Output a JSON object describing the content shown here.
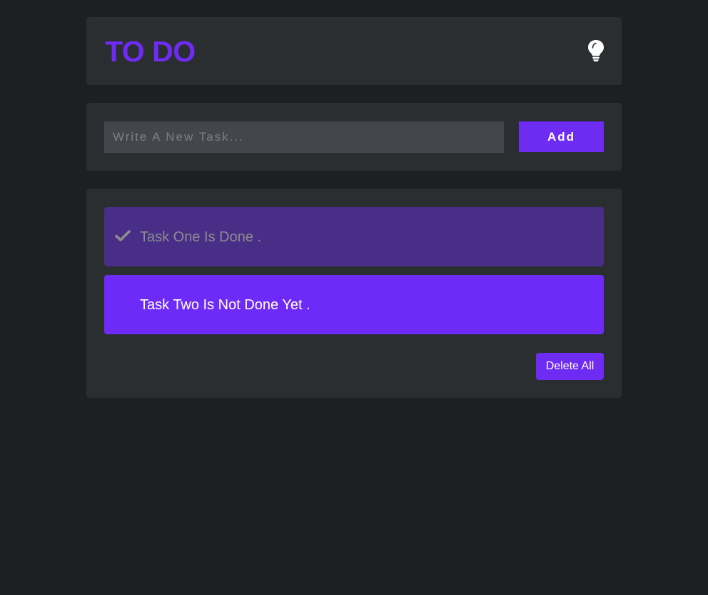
{
  "header": {
    "title": "TO DO",
    "theme_icon": "lightbulb-icon"
  },
  "new_task": {
    "placeholder": "Write A New Task...",
    "value": "",
    "add_label": "Add"
  },
  "tasks": [
    {
      "text": "Task One Is Done .",
      "done": true,
      "icon": "check-icon"
    },
    {
      "text": "Task Two Is Not Done Yet .",
      "done": false
    }
  ],
  "actions": {
    "delete_all_label": "Delete All"
  },
  "colors": {
    "background": "#1d1f21",
    "card": "#2b2e31",
    "accent": "#6e2bf2",
    "task_done": "#482e86",
    "task_pending": "#6e2bf8",
    "input": "#43474b"
  }
}
